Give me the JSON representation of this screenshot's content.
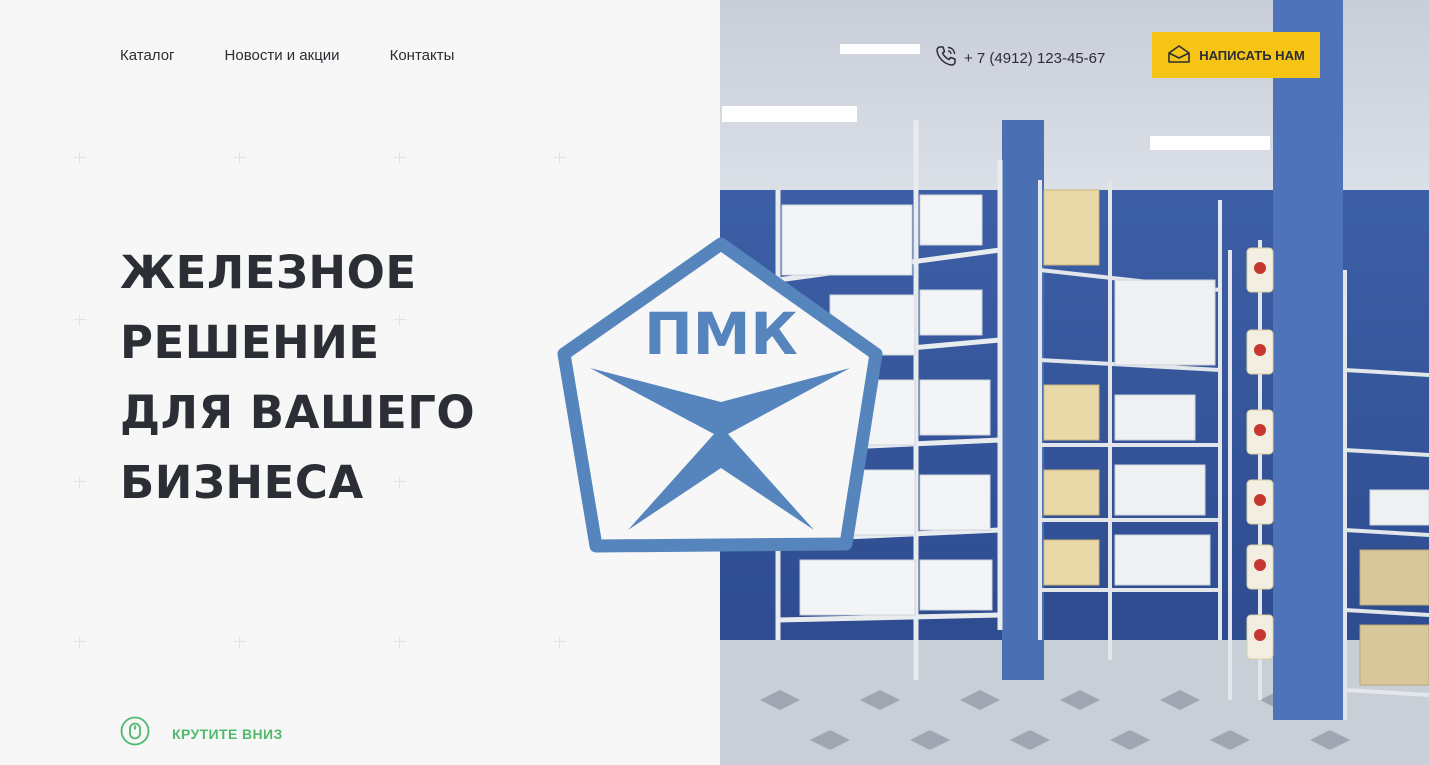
{
  "nav": {
    "items": [
      {
        "label": "Каталог"
      },
      {
        "label": "Новости и акции"
      },
      {
        "label": "Контакты"
      }
    ]
  },
  "hero": {
    "title_lines": [
      "ЖЕЛЕЗНОЕ",
      "РЕШЕНИЕ",
      "ДЛЯ ВАШЕГО",
      "БИЗНЕСА"
    ]
  },
  "scroll_hint": {
    "label": "КРУТИТЕ ВНИЗ",
    "icon": "mouse-icon"
  },
  "contact": {
    "phone": "+ 7 (4912) 123-45-67",
    "phone_icon": "phone-icon",
    "cta_label": "НАПИСАТЬ НАМ",
    "cta_icon": "envelope-icon"
  },
  "logo": {
    "text": "ПМК"
  },
  "colors": {
    "accent_yellow": "#f6c415",
    "logo_blue": "#5585bc",
    "scroll_green": "#4fb96e",
    "text_dark": "#2b2e35"
  }
}
